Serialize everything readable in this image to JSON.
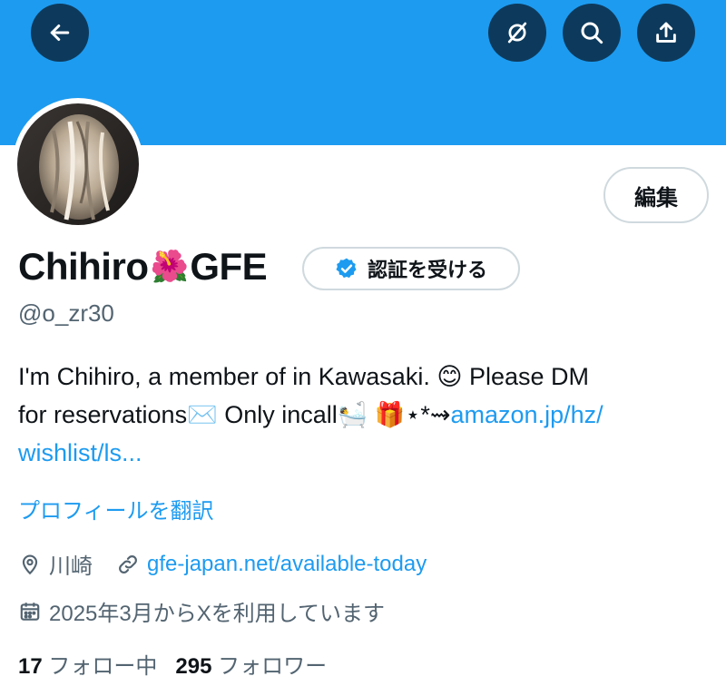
{
  "header": {
    "back_icon": "arrow-left-icon",
    "grok_icon": "slashed-circle-icon",
    "search_icon": "search-icon",
    "share_icon": "share-icon",
    "banner_color": "#1d9bf0"
  },
  "profile": {
    "edit_label": "編集",
    "name_first": "Chihiro",
    "name_emoji": "🌺",
    "name_last": "GFE",
    "verify_label": "認証を受ける",
    "handle": "@o_zr30",
    "bio_line1": "I'm Chihiro, a member of in Kawasaki. 😊 Please DM",
    "bio_line2_text": "for reservations✉️ Only incall🛀 🎁⋆*⇝",
    "bio_line2_link": "amazon.jp/hz/",
    "bio_line3_link": "wishlist/ls...",
    "translate_label": "プロフィールを翻訳",
    "location": "川崎",
    "website": "gfe-japan.net/available-today",
    "joined": "2025年3月からXを利用しています",
    "following_count": "17",
    "following_label": "フォロー中",
    "followers_count": "295",
    "followers_label": "フォロワー",
    "accent_color": "#1d9bf0"
  }
}
